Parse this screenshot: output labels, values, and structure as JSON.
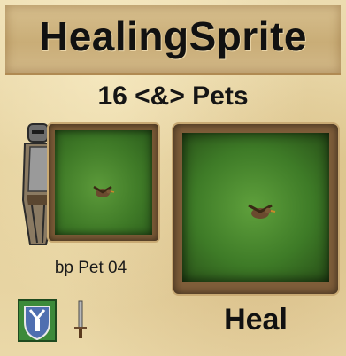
{
  "header": {
    "title": "HealingSprite"
  },
  "summary": {
    "pets_line": "16 <&> Pets"
  },
  "preview": {
    "pet_name": "bp Pet 04"
  },
  "ability": {
    "name": "Heal"
  },
  "icons": {
    "faction": "shield-icon",
    "weapon": "sword-icon",
    "hero": "knight-figure",
    "creature": "bird-sprite"
  },
  "colors": {
    "parchment": "#e8d6a6",
    "grass": "#3f7a27",
    "frame": "#7a5a36",
    "text": "#111111",
    "shield_blue": "#4f6fb0",
    "shield_green": "#3c8a3a"
  }
}
